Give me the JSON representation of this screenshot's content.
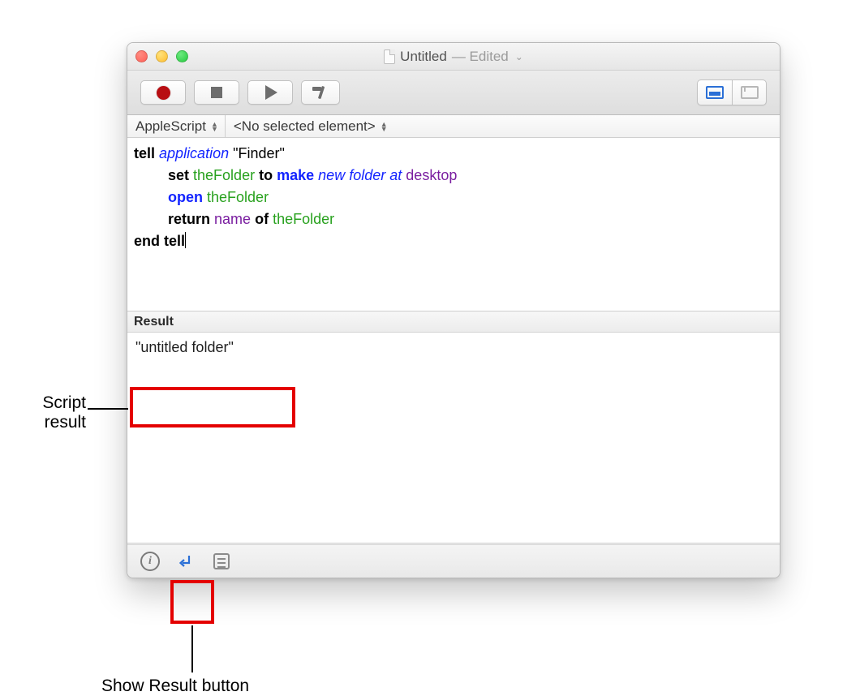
{
  "window": {
    "title": "Untitled",
    "status": "— Edited"
  },
  "navbar": {
    "language": "AppleScript",
    "element": "<No selected element>"
  },
  "script": {
    "l1_tell": "tell",
    "l1_application": "application",
    "l1_target": "\"Finder\"",
    "l2_set": "set",
    "l2_var": "theFolder",
    "l2_to": "to",
    "l2_make": "make",
    "l2_new": "new",
    "l2_folder": "folder",
    "l2_at": "at",
    "l2_desktop": "desktop",
    "l3_open": "open",
    "l3_var": "theFolder",
    "l4_return": "return",
    "l4_name": "name",
    "l4_of": "of",
    "l4_var": "theFolder",
    "l5_end": "end",
    "l5_tell": "tell"
  },
  "result": {
    "heading": "Result",
    "value": "\"untitled folder\""
  },
  "toolbar": {
    "record": "record-button",
    "stop": "stop-button",
    "run": "run-button",
    "compile": "compile-button"
  },
  "callouts": {
    "script_result": "Script\nresult",
    "show_result": "Show Result button"
  }
}
